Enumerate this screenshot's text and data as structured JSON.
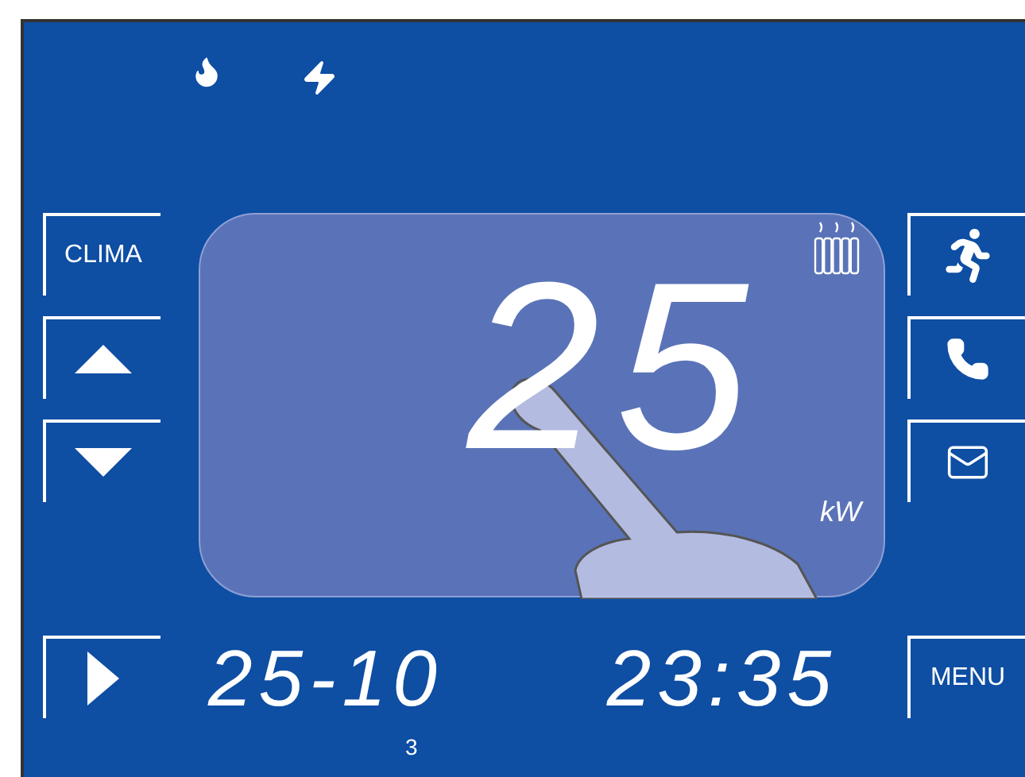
{
  "status_icons": [
    {
      "kind": "flame"
    },
    {
      "kind": "bolt"
    }
  ],
  "left_buttons": [
    {
      "kind": "text",
      "label": "CLIMA"
    },
    {
      "kind": "up"
    },
    {
      "kind": "down"
    }
  ],
  "right_buttons": [
    {
      "kind": "run"
    },
    {
      "kind": "phone"
    },
    {
      "kind": "mail"
    }
  ],
  "display": {
    "value": "25",
    "unit": "kW"
  },
  "date": "25-10",
  "time": "23:35",
  "day": "3",
  "menu_button": "MENU"
}
